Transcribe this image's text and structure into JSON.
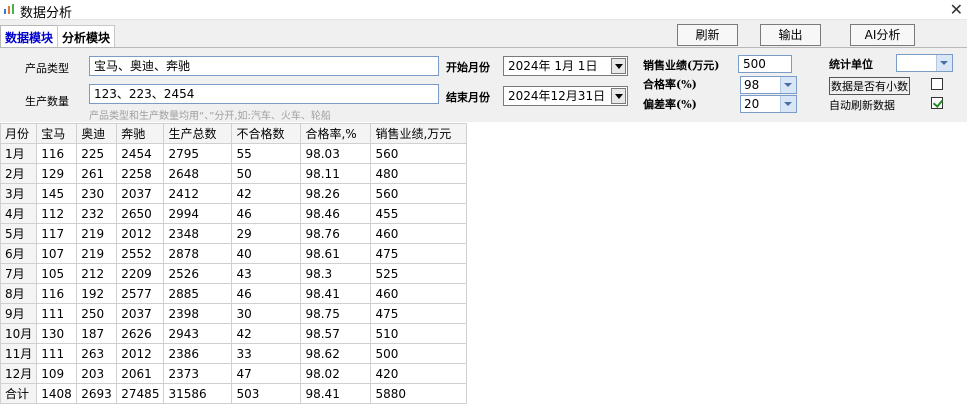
{
  "window": {
    "title": "数据分析",
    "close_label": "✕"
  },
  "tabs": [
    {
      "label": "数据模块"
    },
    {
      "label": "分析模块"
    }
  ],
  "toolbar": {
    "refresh_label": "刷新",
    "export_label": "输出",
    "ai_label": "AI分析"
  },
  "form": {
    "product_type_label": "产品类型",
    "product_type_value": "宝马、奥迪、奔驰",
    "production_qty_label": "生产数量",
    "production_qty_value": "123、223、2454",
    "hint": "产品类型和生产数量均用“、”分开,如:汽车、火车、轮船",
    "start_month_label": "开始月份",
    "start_month_value": "2024年 1月 1日",
    "end_month_label": "结束月份",
    "end_month_value": "2024年12月31日",
    "sales_label": "销售业绩(万元)",
    "sales_value": "500",
    "pass_rate_label": "合格率(%)",
    "pass_rate_value": "98",
    "deviation_label": "偏差率(%)",
    "deviation_value": "20",
    "unit_label": "统计单位",
    "unit_value": "",
    "decimal_label": "数据是否有小数",
    "decimal_checked": false,
    "auto_refresh_label": "自动刷新数据",
    "auto_refresh_checked": true
  },
  "table": {
    "headers": [
      "月份",
      "宝马",
      "奥迪",
      "奔驰",
      "生产总数",
      "不合格数",
      "合格率,%",
      "销售业绩,万元"
    ],
    "rows": [
      [
        "1月",
        "116",
        "225",
        "2454",
        "2795",
        "55",
        "98.03",
        "560"
      ],
      [
        "2月",
        "129",
        "261",
        "2258",
        "2648",
        "50",
        "98.11",
        "480"
      ],
      [
        "3月",
        "145",
        "230",
        "2037",
        "2412",
        "42",
        "98.26",
        "560"
      ],
      [
        "4月",
        "112",
        "232",
        "2650",
        "2994",
        "46",
        "98.46",
        "455"
      ],
      [
        "5月",
        "117",
        "219",
        "2012",
        "2348",
        "29",
        "98.76",
        "460"
      ],
      [
        "6月",
        "107",
        "219",
        "2552",
        "2878",
        "40",
        "98.61",
        "475"
      ],
      [
        "7月",
        "105",
        "212",
        "2209",
        "2526",
        "43",
        "98.3",
        "525"
      ],
      [
        "8月",
        "116",
        "192",
        "2577",
        "2885",
        "46",
        "98.41",
        "460"
      ],
      [
        "9月",
        "111",
        "250",
        "2037",
        "2398",
        "30",
        "98.75",
        "475"
      ],
      [
        "10月",
        "130",
        "187",
        "2626",
        "2943",
        "42",
        "98.57",
        "510"
      ],
      [
        "11月",
        "111",
        "263",
        "2012",
        "2386",
        "33",
        "98.62",
        "500"
      ],
      [
        "12月",
        "109",
        "203",
        "2061",
        "2373",
        "47",
        "98.02",
        "420"
      ],
      [
        "合计",
        "1408",
        "2693",
        "27485",
        "31586",
        "503",
        "98.41",
        "5880"
      ]
    ]
  }
}
